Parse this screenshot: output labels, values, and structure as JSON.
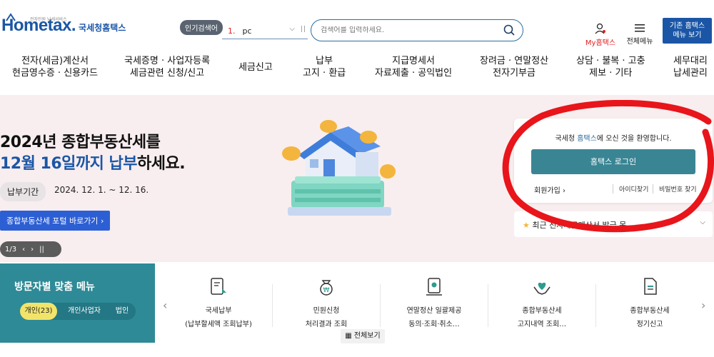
{
  "header": {
    "logo_text": "Hometax.",
    "logo_tagline": "전자민원 납세서비스",
    "logo_sub": "국세청홈택스",
    "popular_badge": "인기검색어",
    "popular_rank": "1.",
    "popular_term": "pc",
    "search_placeholder": "검색어를 입력하세요.",
    "my_home": "My홈택스",
    "all_menu": "전체메뉴",
    "classic_line1": "기존 홈택스",
    "classic_line2": "메뉴 보기"
  },
  "gnb": [
    {
      "l1": "전자(세금)계산서",
      "l2": "현금영수증 · 신용카드"
    },
    {
      "l1": "국세증명 · 사업자등록",
      "l2": "세금관련 신청/신고"
    },
    {
      "l1": "세금신고",
      "l2": ""
    },
    {
      "l1": "납부",
      "l2": "고지 · 환급"
    },
    {
      "l1": "지급명세서",
      "l2": "자료제출 · 공익법인"
    },
    {
      "l1": "장려금 · 연말정산",
      "l2": "전자기부금"
    },
    {
      "l1": "상담 · 불복 · 고충",
      "l2": "제보 · 기타"
    },
    {
      "l1": "세무대리",
      "l2": "납세관리"
    }
  ],
  "hero": {
    "title1": "2024년 종합부동산세를",
    "title2_blue": "12월 16일까지 납부",
    "title2_rest": "하세요.",
    "period_label": "납부기간",
    "period_value": "2024. 12. 1. ~ 12. 16.",
    "portal_button": "종합부동산세 포털 바로가기",
    "slide_counter": "1/3"
  },
  "login": {
    "welcome_pre": "국세청 ",
    "welcome_hl": "홈택스",
    "welcome_post": "에 오신 것을 환영합니다.",
    "login_button": "홈택스 로그인",
    "signup": "회원가입",
    "find_id": "아이디찾기",
    "find_pw": "비밀번호 찾기"
  },
  "recent": {
    "text": "최근 전자세금계산서 발급 목..."
  },
  "visitor": {
    "title": "방문자별 맞춤 메뉴",
    "tabs": [
      "개인(23)",
      "개인사업자",
      "법인"
    ]
  },
  "quick_menu": [
    {
      "l1": "국세납부",
      "l2": "(납부할세액 조회납부)",
      "icon": "tax-payment-icon"
    },
    {
      "l1": "민원신청",
      "l2": "처리결과 조회",
      "icon": "money-bag-icon"
    },
    {
      "l1": "연말정산 일괄제공",
      "l2": "동의·조회·취소…",
      "icon": "certificate-icon"
    },
    {
      "l1": "종합부동산세",
      "l2": "고지내역 조회…",
      "icon": "heart-hands-icon"
    },
    {
      "l1": "종합부동산세",
      "l2": "정기신고",
      "icon": "document-icon"
    }
  ],
  "view_all": "전체보기",
  "colors": {
    "brand_blue": "#1b56a6",
    "teal": "#2e8a96",
    "annotation_red": "#e8151b"
  }
}
